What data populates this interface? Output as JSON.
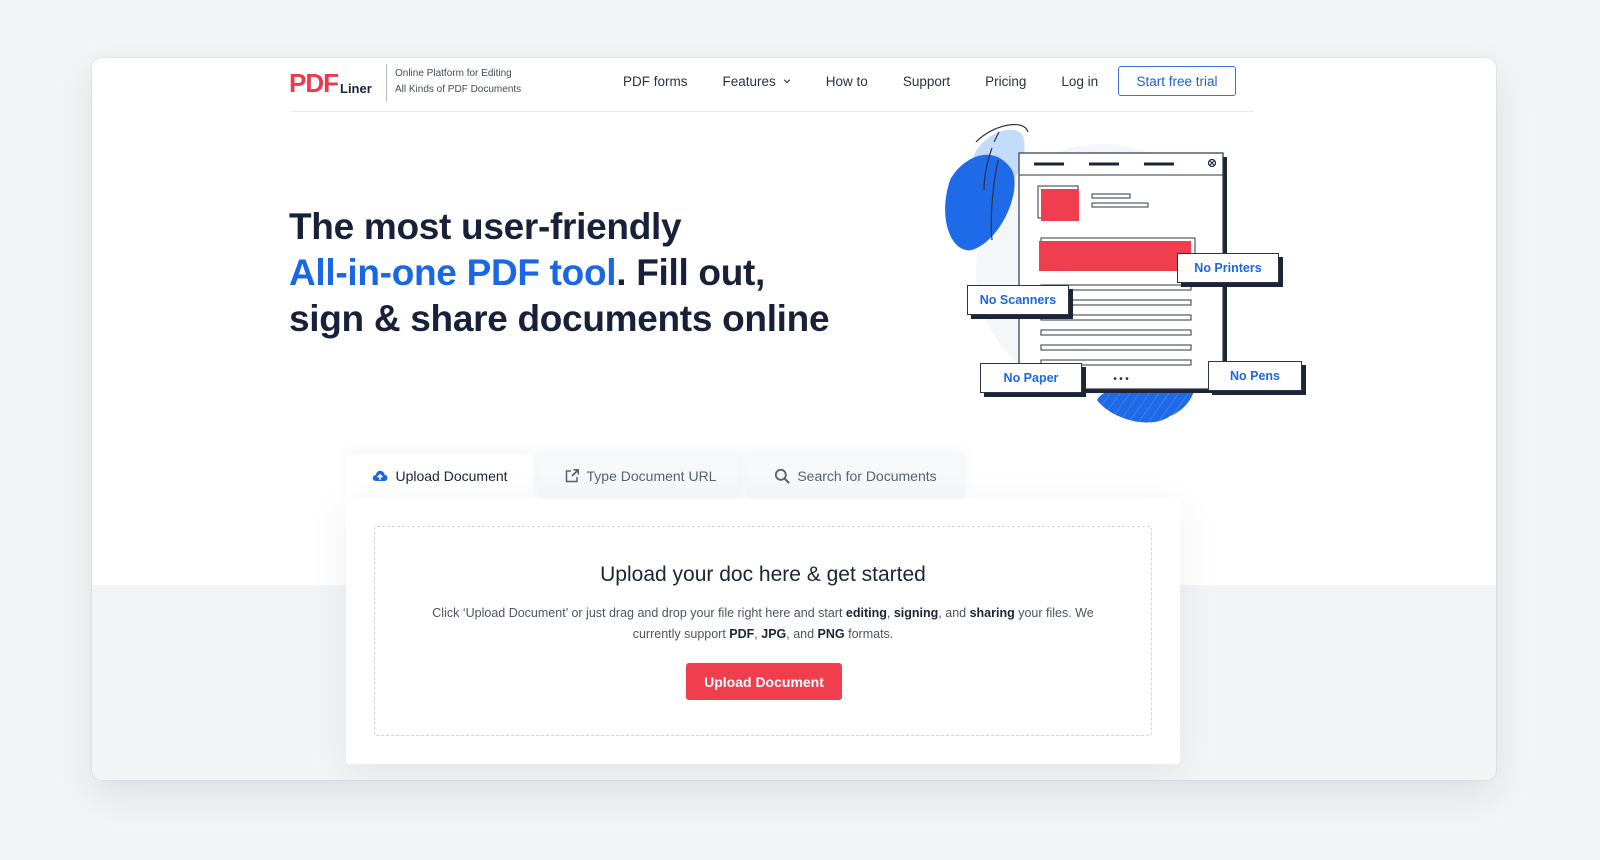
{
  "brand": {
    "logo_main": "PDF",
    "logo_suffix": "Liner",
    "tagline_line1": "Online Platform for Editing",
    "tagline_line2": "All Kinds of PDF Documents",
    "accent_color": "#ea3a4b",
    "primary_blue": "#1a67e6"
  },
  "nav": {
    "items": [
      {
        "label": "PDF forms"
      },
      {
        "label": "Features",
        "has_dropdown": true
      },
      {
        "label": "How to"
      },
      {
        "label": "Support"
      },
      {
        "label": "Pricing"
      },
      {
        "label": "Log in"
      }
    ],
    "cta_label": "Start free trial"
  },
  "hero": {
    "line1": "The most user-friendly",
    "line2_accent": "All-in-one PDF tool",
    "line2_rest": ". Fill out,",
    "line3": "sign & share documents online"
  },
  "illustration": {
    "tags": [
      "No Printers",
      "No Scanners",
      "No Paper",
      "No Pens"
    ],
    "ellipsis": "•••"
  },
  "tabs": [
    {
      "label": "Upload Document",
      "icon": "cloud-upload-icon",
      "active": true
    },
    {
      "label": "Type Document URL",
      "icon": "external-link-icon",
      "active": false
    },
    {
      "label": "Search for Documents",
      "icon": "search-icon",
      "active": false
    }
  ],
  "upload": {
    "title": "Upload your doc here & get started",
    "desc_1": "Click ‘Upload Document’ or just drag and drop your file right here and start ",
    "desc_b1": "editing",
    "desc_2": ", ",
    "desc_b2": "signing",
    "desc_3": ", and ",
    "desc_b3": "sharing",
    "desc_4": " your files. We currently support ",
    "desc_b4": "PDF",
    "desc_5": ", ",
    "desc_b5": "JPG",
    "desc_6": ", and ",
    "desc_b6": "PNG",
    "desc_7": " formats.",
    "button_label": "Upload Document",
    "button_color": "#f03e4e"
  }
}
